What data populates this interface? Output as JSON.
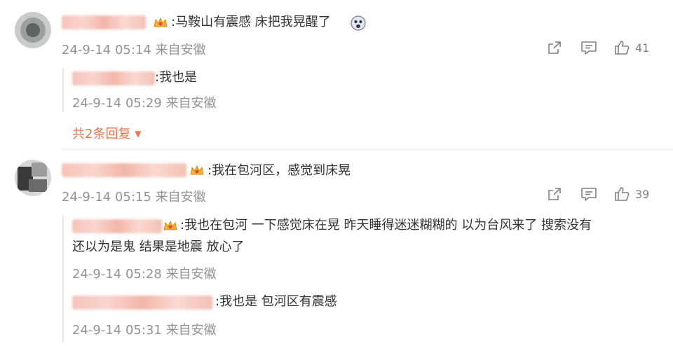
{
  "comments": [
    {
      "text": ":马鞍山有震感 床把我晃醒了",
      "meta": "24-9-14 05:14 来自安徽",
      "like_count": "41",
      "replies": [
        {
          "text": ":我也是",
          "meta": "24-9-14 05:29 来自安徽"
        }
      ],
      "more_label": "共2条回复"
    },
    {
      "text": ":我在包河区，感觉到床晃",
      "meta": "24-9-14 05:15 来自安徽",
      "like_count": "39",
      "replies": [
        {
          "text_line1": ":我也在包河 一下感觉床在晃 昨天睡得迷迷糊糊的 以为台风来了 搜索没有",
          "text_line2": "还以为是鬼 结果是地震 放心了",
          "meta": "24-9-14 05:28 来自安徽"
        },
        {
          "text": ":我也是 包河区有震感",
          "meta": "24-9-14 05:31 来自安徽"
        }
      ]
    }
  ],
  "icons": {
    "share": "share-icon",
    "comment": "comment-icon",
    "like": "thumbs-up-icon",
    "badge": "crown-badge-icon",
    "emoji": "scared-face-emoji-icon",
    "more": "caret-down-icon"
  },
  "colors": {
    "accent": "#eb7350",
    "meta": "#939393",
    "text": "#333333"
  }
}
